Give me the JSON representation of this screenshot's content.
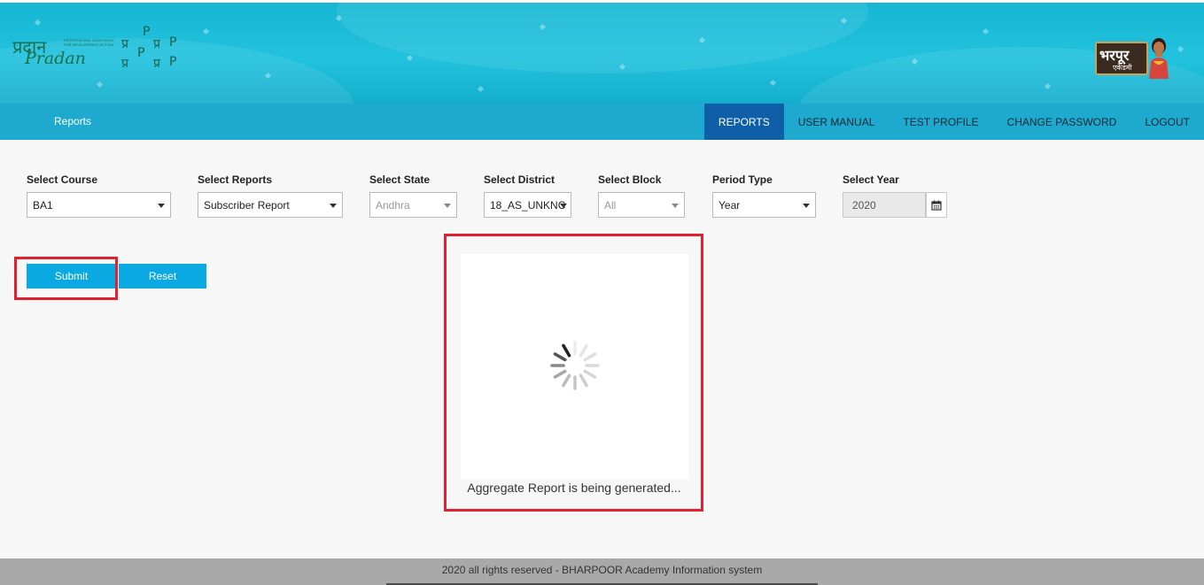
{
  "header": {
    "pradan_logo_hindi": "प्रदान",
    "pradan_logo_text": "Pradan",
    "pradan_tagline": "PROFESSIONAL ASSISTANCE FOR DEVELOPMENT ACTION",
    "grid_logo_letters": [
      "P",
      "प्र",
      "P",
      "प्र",
      "P",
      "प्र",
      "P",
      "प्र"
    ],
    "bharpoor_logo_title": "भरपूर",
    "bharpoor_logo_sub": "एकेडमी"
  },
  "navbar": {
    "brand": "Reports",
    "menu": [
      {
        "label": "REPORTS",
        "active": true
      },
      {
        "label": "USER MANUAL",
        "active": false
      },
      {
        "label": "TEST PROFILE",
        "active": false
      },
      {
        "label": "CHANGE PASSWORD",
        "active": false
      },
      {
        "label": "LOGOUT",
        "active": false
      }
    ]
  },
  "filters": {
    "course": {
      "label": "Select Course",
      "value": "BA1"
    },
    "reports": {
      "label": "Select Reports",
      "value": "Subscriber Report"
    },
    "state": {
      "label": "Select State",
      "value": "Andhra"
    },
    "district": {
      "label": "Select District",
      "value": "18_AS_UNKNC"
    },
    "block": {
      "label": "Select Block",
      "value": "All"
    },
    "period": {
      "label": "Period Type",
      "value": "Year"
    },
    "year": {
      "label": "Select Year",
      "value": "2020"
    }
  },
  "actions": {
    "submit": "Submit",
    "reset": "Reset"
  },
  "loader": {
    "message": "Aggregate Report is being generated..."
  },
  "footer": {
    "text": "2020 all rights reserved - BHARPOOR Academy Information system"
  },
  "colors": {
    "banner": "#17b7d4",
    "navbar": "#1ea9cf",
    "nav_active": "#0f5fa8",
    "button": "#0ba9e2",
    "highlight": "#e02230",
    "footer": "#a9a9a9"
  }
}
